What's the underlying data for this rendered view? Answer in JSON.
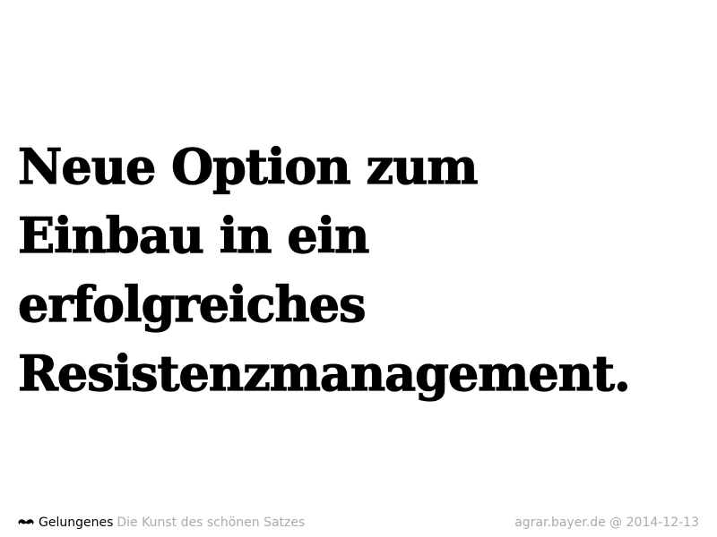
{
  "headline": {
    "lines": [
      "Neue Option zum",
      "Einbau in ein",
      "erfolgreiches",
      "Resistenzmanagement."
    ]
  },
  "footer": {
    "icon": "mustache-icon",
    "brand": "Gelungenes",
    "tagline": "Die Kunst des schönen Satzes",
    "credit": "agrar.bayer.de @ 2014-12-13"
  },
  "colors": {
    "text": "#000000",
    "muted": "#aaaaaa",
    "background": "#ffffff"
  }
}
